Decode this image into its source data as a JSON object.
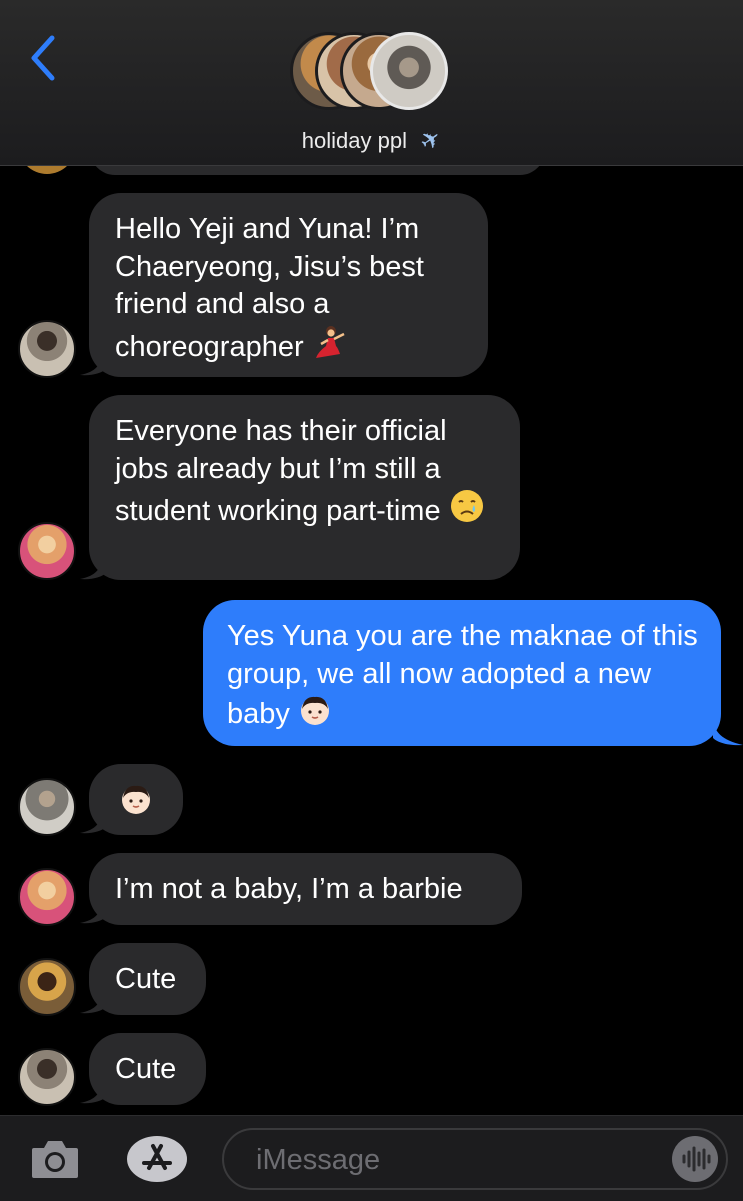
{
  "header": {
    "back_label": "<",
    "title": "holiday ppl",
    "title_emoji": "✈"
  },
  "messages": [
    {
      "direction": "incoming",
      "sender_avatar": "avatar-gray",
      "text": "Hello Yeji and Yuna! I’m Chaeryeong, Jisu’s best friend and also a choreographer",
      "emoji": "dancer-emoji"
    },
    {
      "direction": "incoming",
      "sender_avatar": "avatar-pink",
      "text": "Everyone has their official jobs already but I’m still a student working part-time",
      "emoji": "crying-face-emoji"
    },
    {
      "direction": "outgoing",
      "text": "Yes Yuna you are the maknae of this group, we all now adopted a new baby",
      "emoji": "baby-emoji"
    },
    {
      "direction": "incoming",
      "sender_avatar": "avatar-hallway",
      "text": "",
      "emoji": "baby-emoji"
    },
    {
      "direction": "incoming",
      "sender_avatar": "avatar-pink",
      "text": "I’m not a baby, I’m a barbie"
    },
    {
      "direction": "incoming",
      "sender_avatar": "avatar-gold",
      "text": "Cute"
    },
    {
      "direction": "incoming",
      "sender_avatar": "avatar-gray",
      "text": "Cute"
    }
  ],
  "compose": {
    "placeholder": "iMessage"
  },
  "colors": {
    "incoming_bubble": "#2a2a2c",
    "outgoing_bubble": "#2e7dfb",
    "accent": "#2e7dfb",
    "background": "#000000"
  }
}
